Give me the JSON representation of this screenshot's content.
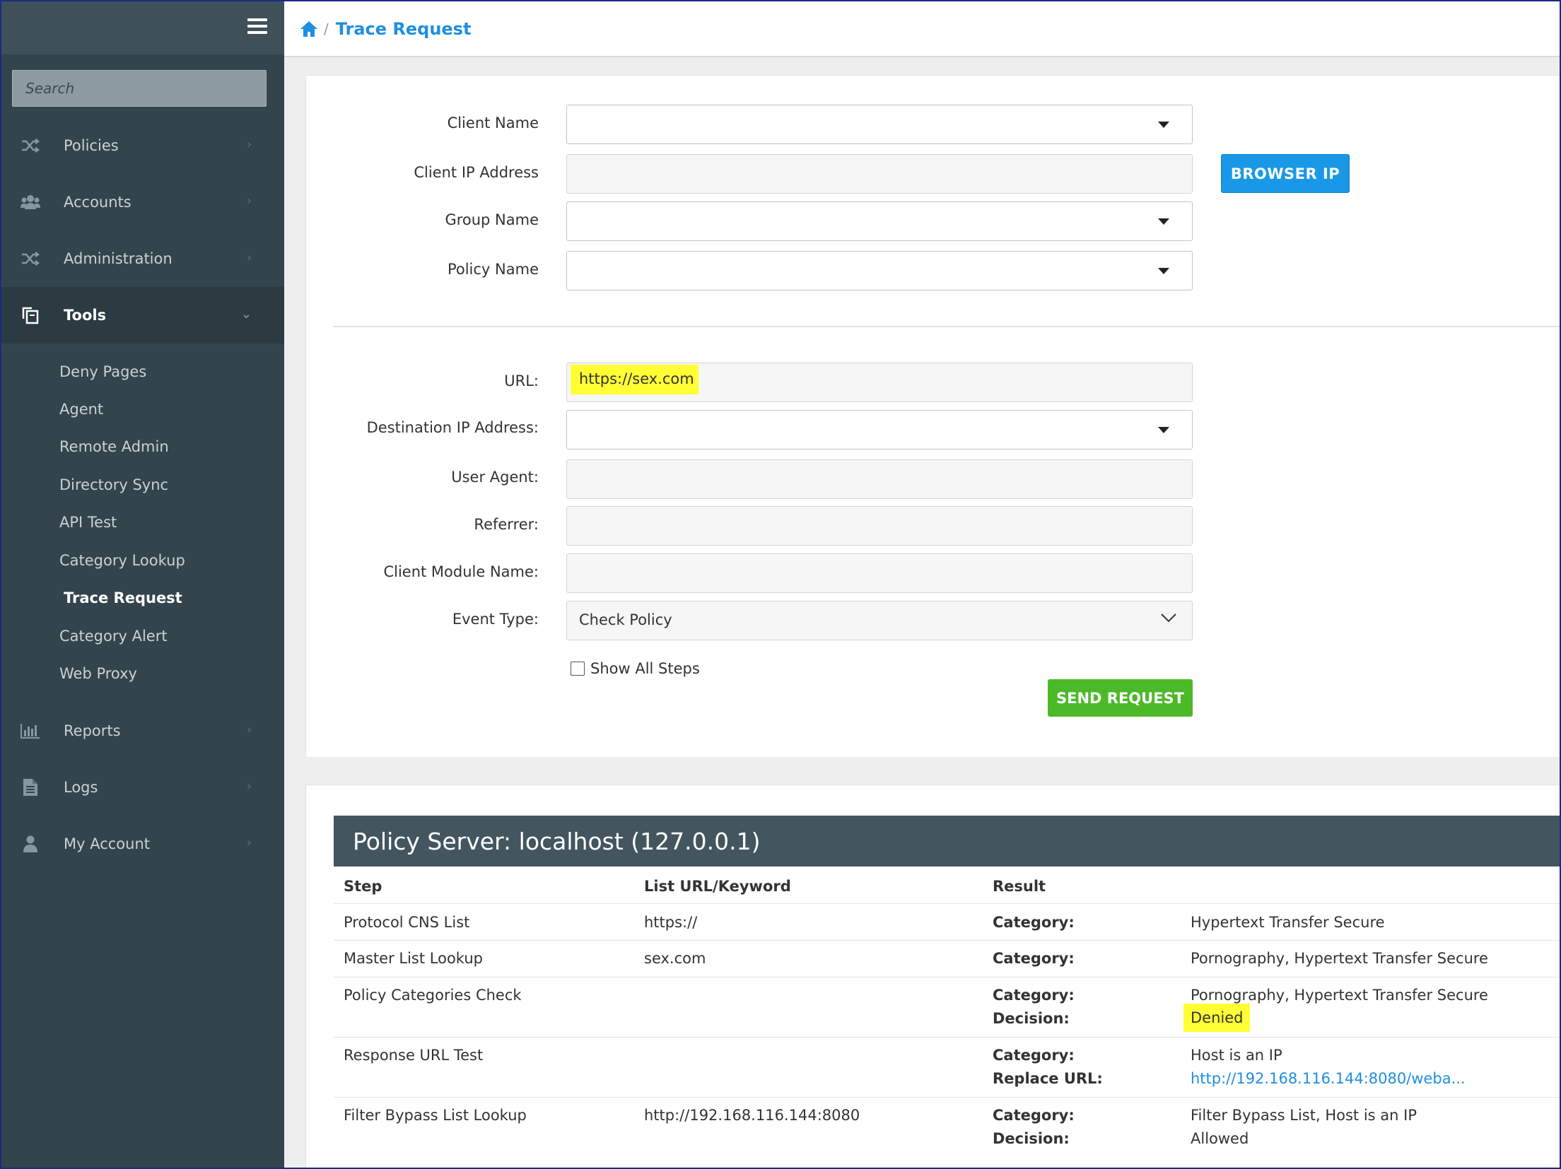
{
  "sidebar": {
    "search_placeholder": "Search",
    "items": [
      {
        "label": "Policies",
        "icon": "shuffle-icon"
      },
      {
        "label": "Accounts",
        "icon": "users-icon"
      },
      {
        "label": "Administration",
        "icon": "shuffle-icon"
      },
      {
        "label": "Tools",
        "icon": "tools-icon"
      },
      {
        "label": "Reports",
        "icon": "bar-chart-icon"
      },
      {
        "label": "Logs",
        "icon": "document-icon"
      },
      {
        "label": "My Account",
        "icon": "user-icon"
      }
    ],
    "tools_submenu": [
      "Deny Pages",
      "Agent",
      "Remote Admin",
      "Directory Sync",
      "API Test",
      "Category Lookup",
      "Trace Request",
      "Category Alert",
      "Web Proxy"
    ]
  },
  "header": {
    "breadcrumb_sep": "/",
    "title": "Trace Request"
  },
  "form": {
    "client_name_label": "Client Name",
    "client_ip_label": "Client IP Address",
    "group_name_label": "Group Name",
    "policy_name_label": "Policy Name",
    "browser_ip_button": "BROWSER IP",
    "url_label": "URL:",
    "url_value": "https://sex.com",
    "dest_ip_label": "Destination IP Address:",
    "user_agent_label": "User Agent:",
    "referrer_label": "Referrer:",
    "client_module_label": "Client Module Name:",
    "event_type_label": "Event Type:",
    "event_type_value": "Check Policy",
    "show_all_steps_label": "Show All Steps",
    "send_button": "SEND REQUEST"
  },
  "results": {
    "title": "Policy Server: localhost (127.0.0.1)",
    "columns": [
      "Step",
      "List URL/Keyword",
      "Result"
    ],
    "rows": [
      {
        "step": "Protocol CNS List",
        "keyword": "https://",
        "result_labels": [
          "Category:"
        ],
        "result_values": [
          "Hypertext Transfer Secure"
        ]
      },
      {
        "step": "Master List Lookup",
        "keyword": "sex.com",
        "result_labels": [
          "Category:"
        ],
        "result_values": [
          "Pornography, Hypertext Transfer Secure"
        ]
      },
      {
        "step": "Policy Categories Check",
        "keyword": "",
        "result_labels": [
          "Category:",
          "Decision:"
        ],
        "result_values": [
          "Pornography, Hypertext Transfer Secure",
          "Denied"
        ]
      },
      {
        "step": "Response URL Test",
        "keyword": "",
        "result_labels": [
          "Category:",
          "Replace URL:"
        ],
        "result_values": [
          "Host is an IP",
          "http://192.168.116.144:8080/weba..."
        ]
      },
      {
        "step": "Filter Bypass List Lookup",
        "keyword": "http://192.168.116.144:8080",
        "result_labels": [
          "Category:",
          "Decision:"
        ],
        "result_values": [
          "Filter Bypass List, Host is an IP",
          "Allowed"
        ]
      }
    ]
  },
  "colors": {
    "sidebar_bg": "#34444d",
    "accent_blue": "#1a98e8",
    "accent_green": "#4cb928",
    "highlight_yellow": "#ffff33",
    "result_header_bg": "#43565f"
  }
}
